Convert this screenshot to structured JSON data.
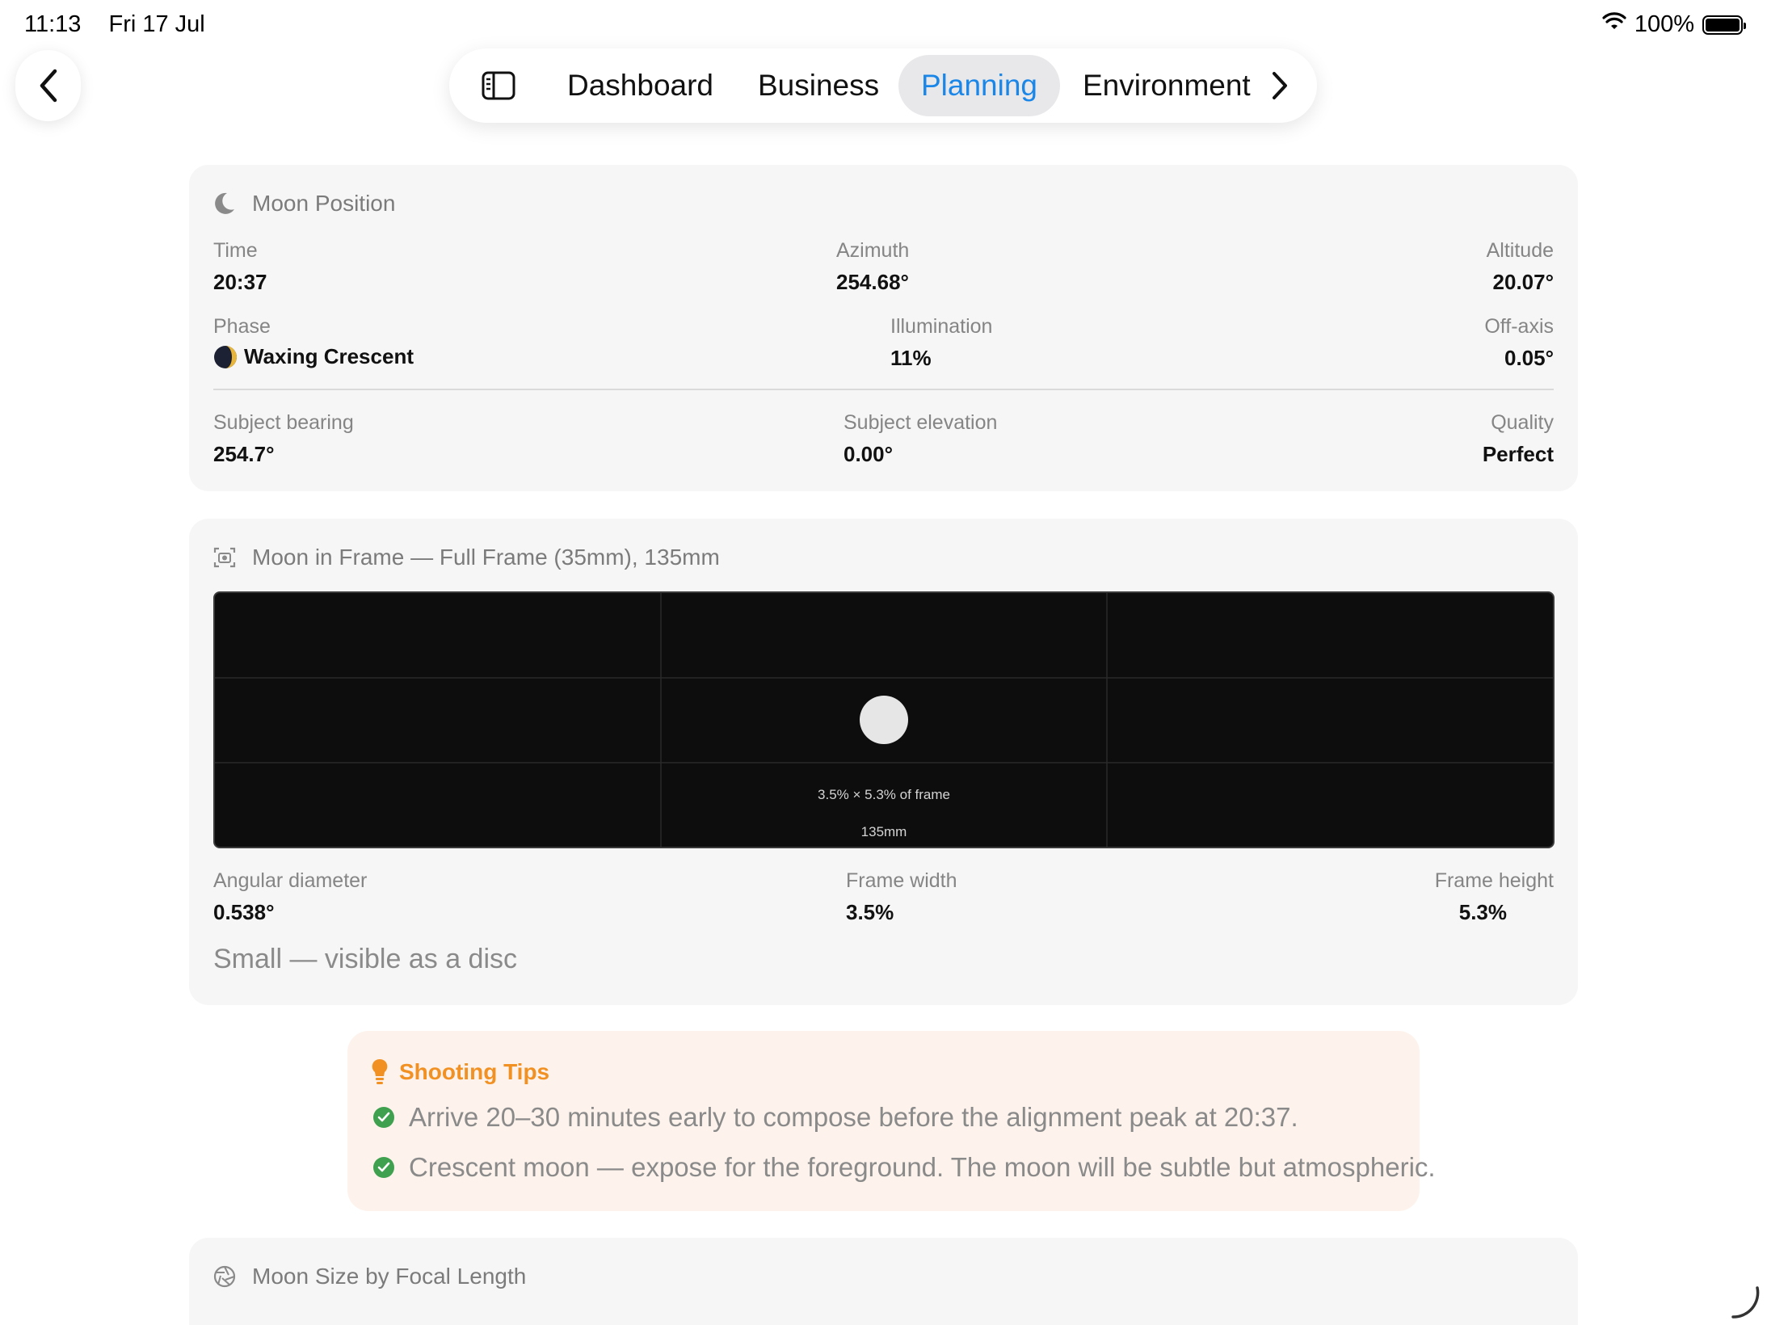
{
  "status": {
    "time": "11:13",
    "date": "Fri 17 Jul",
    "battery": "100%"
  },
  "nav": {
    "tabs": [
      {
        "label": "Dashboard",
        "active": false
      },
      {
        "label": "Business",
        "active": false
      },
      {
        "label": "Planning",
        "active": true
      },
      {
        "label": "Environment",
        "active": false
      }
    ]
  },
  "moon_position": {
    "title": "Moon Position",
    "time": {
      "label": "Time",
      "value": "20:37"
    },
    "azimuth": {
      "label": "Azimuth",
      "value": "254.68°"
    },
    "altitude": {
      "label": "Altitude",
      "value": "20.07°"
    },
    "phase": {
      "label": "Phase",
      "value": "Waxing Crescent"
    },
    "illumination": {
      "label": "Illumination",
      "value": "11%"
    },
    "off_axis": {
      "label": "Off-axis",
      "value": "0.05°"
    },
    "subject_bearing": {
      "label": "Subject bearing",
      "value": "254.7°"
    },
    "subject_elevation": {
      "label": "Subject elevation",
      "value": "0.00°"
    },
    "quality": {
      "label": "Quality",
      "value": "Perfect"
    }
  },
  "moon_in_frame": {
    "title": "Moon in Frame — Full Frame (35mm), 135mm",
    "frame_caption": "3.5% × 5.3% of frame",
    "focal_caption": "135mm",
    "angular_diameter": {
      "label": "Angular diameter",
      "value": "0.538°"
    },
    "frame_width": {
      "label": "Frame width",
      "value": "3.5%"
    },
    "frame_height": {
      "label": "Frame height",
      "value": "5.3%"
    },
    "summary": "Small — visible as a disc"
  },
  "tips": {
    "title": "Shooting Tips",
    "items": [
      "Arrive 20–30 minutes early to compose before the alignment peak at 20:37.",
      "Crescent moon — expose for the foreground. The moon will be subtle but atmospheric."
    ]
  },
  "moon_size": {
    "title": "Moon Size by Focal Length"
  },
  "colors": {
    "accent": "#1a86e8",
    "tips_bg": "#fdf3ec",
    "tips_title": "#f29123",
    "check": "#3fa14f",
    "card_bg": "#f6f6f6"
  },
  "icons": {
    "back": "chevron-left-icon",
    "sidebar": "sidebar-toggle-icon",
    "next": "chevron-right-icon",
    "moon": "moon-icon",
    "frame": "camera-viewfinder-icon",
    "tips": "lightbulb-icon",
    "check": "checkmark-circle-icon",
    "aperture": "aperture-icon"
  }
}
